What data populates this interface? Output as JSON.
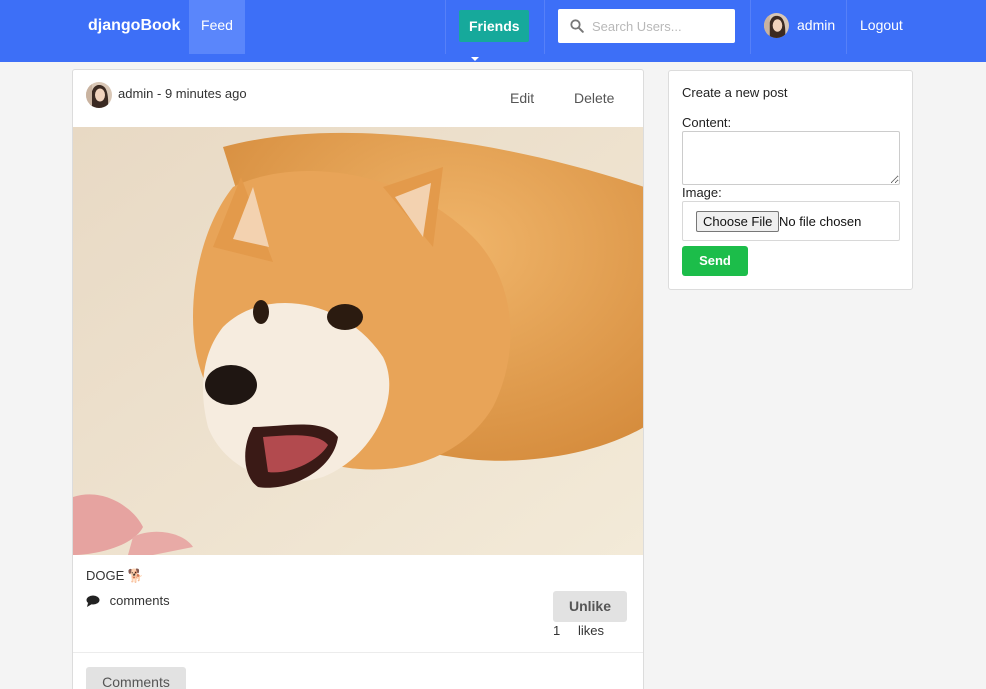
{
  "nav": {
    "brand": "djangoBook",
    "feed": "Feed",
    "friends": "Friends",
    "search_placeholder": "Search Users...",
    "username": "admin",
    "logout": "Logout"
  },
  "post": {
    "author_line": "admin - 9 minutes ago",
    "edit": "Edit",
    "delete": "Delete",
    "text": "DOGE 🐕",
    "comments_link": "comments",
    "unlike": "Unlike",
    "likes_count": "1",
    "likes_label": "likes",
    "comments_button": "Comments"
  },
  "create": {
    "title": "Create a new post",
    "content_label": "Content:",
    "image_label": "Image:",
    "choose_file": "Choose File",
    "file_status": "No file chosen",
    "send": "Send"
  },
  "colors": {
    "nav_bg": "#3d6ff7",
    "friends_btn": "#16a99b",
    "send_btn": "#1cbd4a"
  },
  "icons": [
    "search-icon",
    "comment-bubble-icon",
    "caret-down-icon"
  ]
}
